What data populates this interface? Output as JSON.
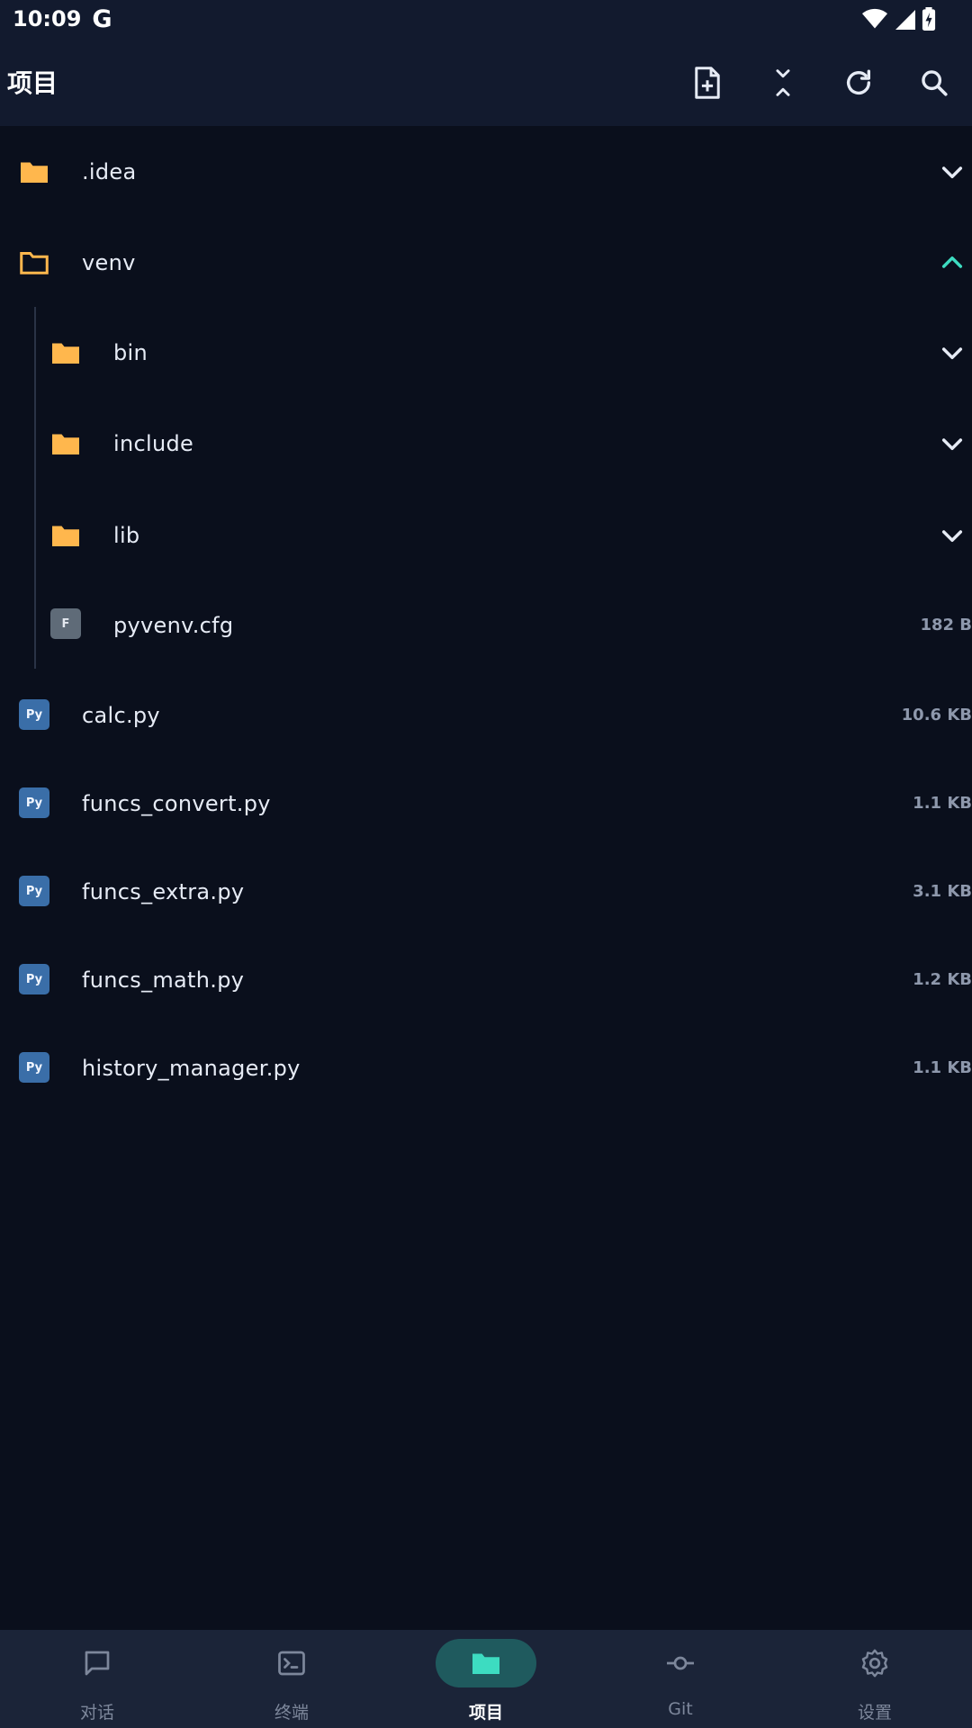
{
  "status": {
    "time": "10:09",
    "google_glyph": "G",
    "icons": [
      "wifi-icon",
      "signal-icon",
      "battery-charging-icon"
    ]
  },
  "appbar": {
    "title": "项目",
    "actions": [
      "new-file-icon",
      "collapse-all-icon",
      "refresh-icon",
      "search-icon"
    ]
  },
  "tree": {
    "items": [
      {
        "name": ".idea",
        "type": "folder",
        "state": "collapsed"
      },
      {
        "name": "venv",
        "type": "folder",
        "state": "expanded"
      },
      {
        "name": "bin",
        "type": "folder",
        "state": "collapsed"
      },
      {
        "name": "include",
        "type": "folder",
        "state": "collapsed"
      },
      {
        "name": "lib",
        "type": "folder",
        "state": "collapsed"
      },
      {
        "name": "pyvenv.cfg",
        "type": "file",
        "badge": "F",
        "size": "182 B"
      },
      {
        "name": "calc.py",
        "type": "python",
        "badge": "Py",
        "size": "10.6 KB"
      },
      {
        "name": "funcs_convert.py",
        "type": "python",
        "badge": "Py",
        "size": "1.1 KB"
      },
      {
        "name": "funcs_extra.py",
        "type": "python",
        "badge": "Py",
        "size": "3.1 KB"
      },
      {
        "name": "funcs_math.py",
        "type": "python",
        "badge": "Py",
        "size": "1.2 KB"
      },
      {
        "name": "history_manager.py",
        "type": "python",
        "badge": "Py",
        "size": "1.1 KB"
      }
    ]
  },
  "bottom_nav": {
    "items": [
      {
        "label": "对话",
        "icon": "chat-icon"
      },
      {
        "label": "终端",
        "icon": "terminal-icon"
      },
      {
        "label": "项目",
        "icon": "folder-icon",
        "active": true
      },
      {
        "label": "Git",
        "icon": "git-commit-icon"
      },
      {
        "label": "设置",
        "icon": "settings-icon"
      }
    ]
  },
  "colors": {
    "background": "#0a0f1c",
    "bar": "#121a2e",
    "folder": "#ffb74d",
    "accent": "#3ddcc1",
    "python_badge": "#3a6ea8",
    "file_badge": "#5f6b78"
  }
}
